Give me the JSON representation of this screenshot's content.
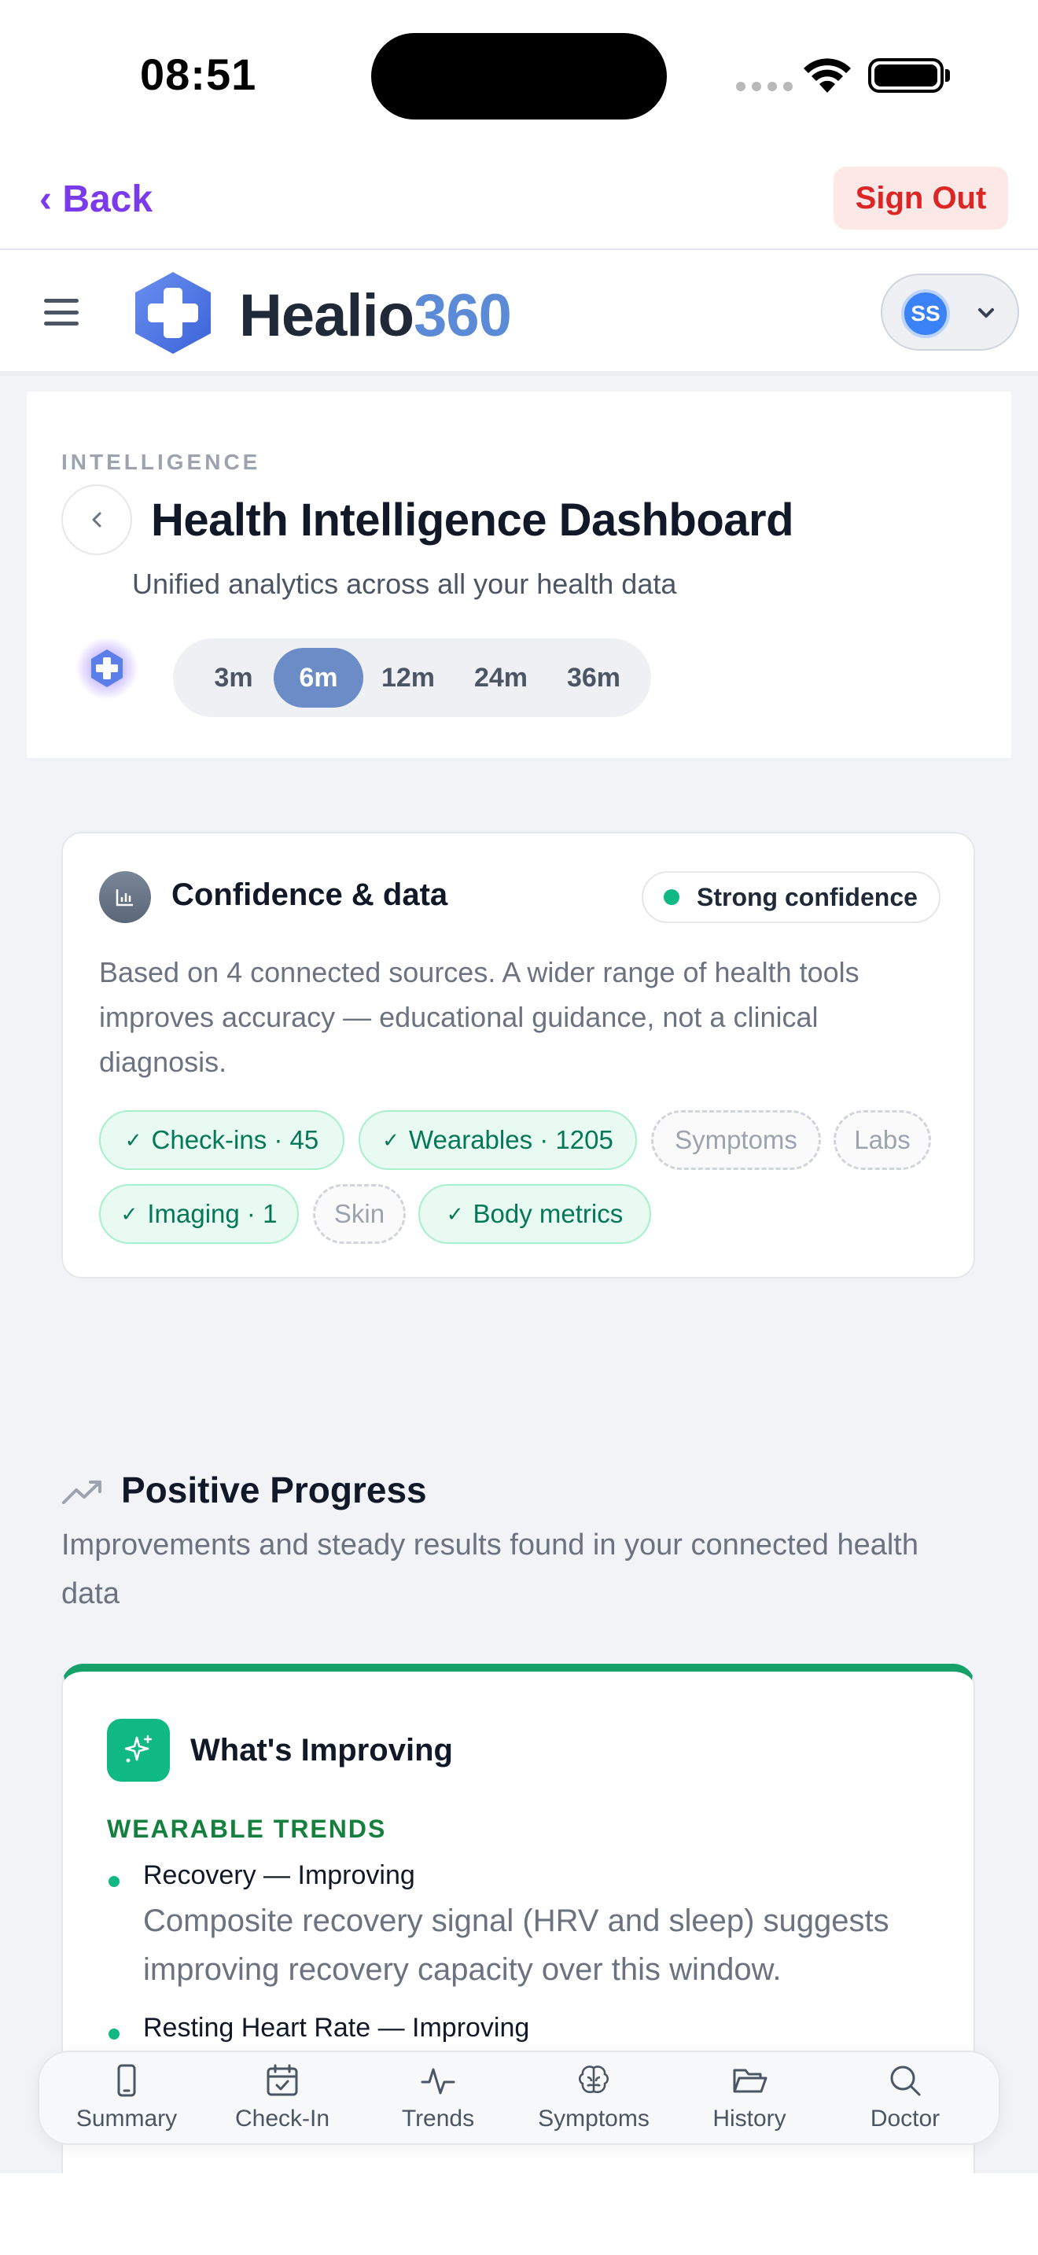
{
  "status_bar": {
    "time": "08:51"
  },
  "nav": {
    "back_label": "‹ Back",
    "sign_out_label": "Sign Out"
  },
  "header": {
    "brand_a": "Healio",
    "brand_b": "360",
    "avatar_initials": "SS"
  },
  "hero": {
    "eyebrow": "INTELLIGENCE",
    "title": "Health Intelligence Dashboard",
    "subtitle": "Unified analytics across all your health data",
    "ranges": [
      "3m",
      "6m",
      "12m",
      "24m",
      "36m"
    ],
    "selected_range": "6m"
  },
  "confidence": {
    "title": "Confidence & data",
    "badge": "Strong confidence",
    "badge_color": "#10b981",
    "description": "Based on 4 connected sources. A wider range of health tools improves accuracy — educational guidance, not a clinical diagnosis.",
    "chips": [
      {
        "label": "Check-ins · 45",
        "connected": true
      },
      {
        "label": "Wearables · 1205",
        "connected": true
      },
      {
        "label": "Symptoms",
        "connected": false
      },
      {
        "label": "Labs",
        "connected": false
      },
      {
        "label": "Imaging · 1",
        "connected": true
      },
      {
        "label": "Skin",
        "connected": false
      },
      {
        "label": "Body metrics",
        "connected": true
      }
    ]
  },
  "progress": {
    "title": "Positive Progress",
    "subtitle": "Improvements and steady results found in your connected health data",
    "card_title": "What's Improving",
    "section_label": "WEARABLE TRENDS",
    "items": [
      {
        "title": "Recovery — Improving",
        "desc": "Composite recovery signal (HRV and sleep) suggests improving recovery capacity over this window."
      },
      {
        "title": "Resting Heart Rate — Improving",
        "desc": ""
      }
    ],
    "accent_color": "#16a06a"
  },
  "tabs": [
    {
      "label": "Summary",
      "icon": "phone-icon"
    },
    {
      "label": "Check-In",
      "icon": "calendar-check-icon"
    },
    {
      "label": "Trends",
      "icon": "activity-icon"
    },
    {
      "label": "Symptoms",
      "icon": "brain-icon"
    },
    {
      "label": "History",
      "icon": "folder-open-icon"
    },
    {
      "label": "Doctor",
      "icon": "search-icon"
    }
  ]
}
